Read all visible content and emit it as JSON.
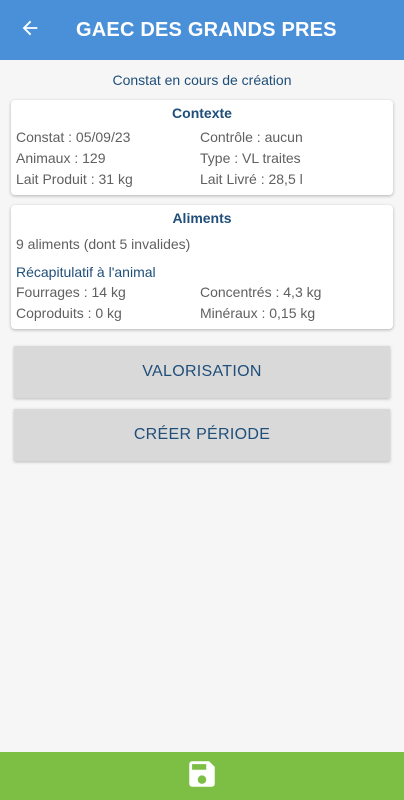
{
  "header": {
    "title": "GAEC DES GRANDS PRES",
    "back_icon": "arrow-left-icon"
  },
  "subtitle": "Constat en cours de création",
  "contexte": {
    "title": "Contexte",
    "constat": "Constat : 05/09/23",
    "controle": "Contrôle : aucun",
    "animaux": "Animaux : 129",
    "type": "Type : VL traites",
    "lait_produit": "Lait Produit : 31 kg",
    "lait_livre": "Lait Livré : 28,5 l"
  },
  "aliments": {
    "title": "Aliments",
    "summary": "9 aliments (dont 5 invalides)",
    "recap_title": "Récapitulatif à l'animal",
    "fourrages": "Fourrages : 14 kg",
    "concentres": "Concentrés : 4,3 kg",
    "coproduits": "Coproduits : 0 kg",
    "mineraux": "Minéraux : 0,15 kg"
  },
  "actions": {
    "valorisation": "VALORISATION",
    "creer_periode": "CRÉER PÉRIODE"
  },
  "footer": {
    "save_icon": "save-icon"
  },
  "colors": {
    "appbar": "#4a90d9",
    "bottombar": "#7cbf44",
    "accent_text": "#1f4e79",
    "button_bg": "#d9d9d9"
  }
}
